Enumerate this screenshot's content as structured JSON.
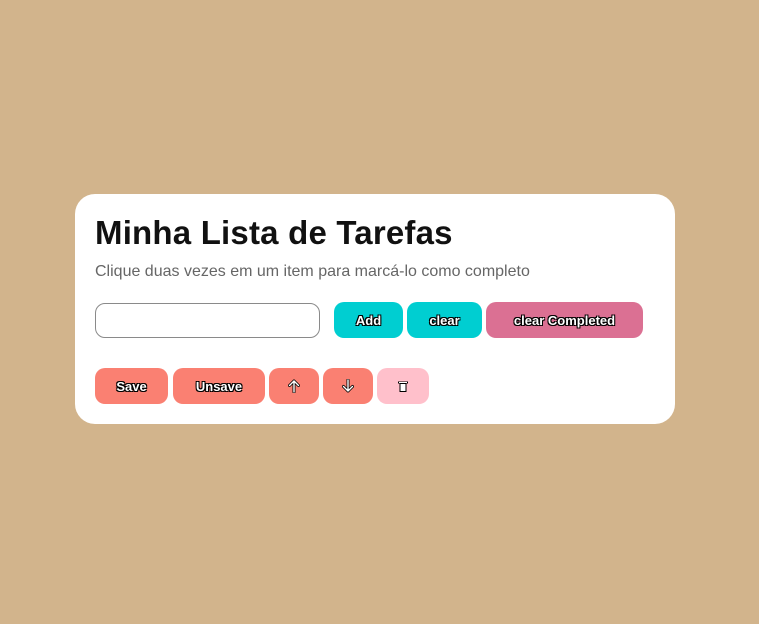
{
  "app": {
    "title": "Minha Lista de Tarefas",
    "subtitle": "Clique duas vezes em um item para marcá-lo como completo"
  },
  "task_input": {
    "value": "",
    "placeholder": ""
  },
  "toolbar": {
    "add_label": "Add",
    "clear_label": "clear",
    "clear_completed_label": "clear Completed",
    "save_label": "Save",
    "unsave_label": "Unsave",
    "move_up_icon": "arrow-up-icon",
    "move_down_icon": "arrow-down-icon",
    "delete_icon": "trash-icon"
  },
  "colors": {
    "background": "#d2b48c",
    "card": "#ffffff",
    "primary_button": "#00ced1",
    "clear_completed_button": "#db7093",
    "secondary_button": "#fa8072",
    "delete_button": "#ffc0cb"
  }
}
